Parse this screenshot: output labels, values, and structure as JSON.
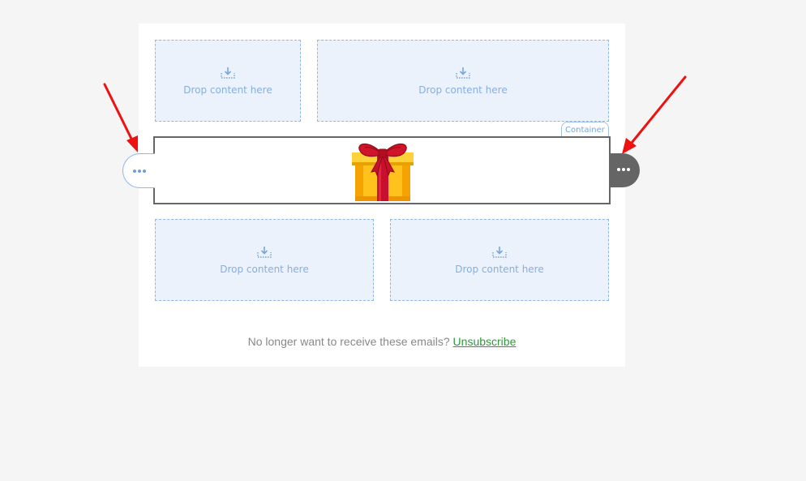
{
  "drop_zones": [
    {
      "label": "Drop content here",
      "icon": "download-tray-icon"
    },
    {
      "label": "Drop content here",
      "icon": "download-tray-icon"
    },
    {
      "label": "Drop content here",
      "icon": "download-tray-icon"
    },
    {
      "label": "Drop content here",
      "icon": "download-tray-icon"
    }
  ],
  "container_tag": {
    "label": "Container"
  },
  "selected_block": {
    "content": "gift-box-image"
  },
  "handles": {
    "left": {
      "icon": "more-dots-icon"
    },
    "right": {
      "icon": "more-dots-icon"
    }
  },
  "footer": {
    "text": "No longer want to receive these emails?",
    "link_label": "Unsubscribe"
  },
  "annotations": {
    "arrow_color": "#ee1111",
    "count": 2
  },
  "colors": {
    "drop_zone_bg": "#ebf2fc",
    "drop_zone_border": "#8fb8e6",
    "selected_border": "#666666",
    "link": "#2a9a3a",
    "page_bg": "#f5f5f5"
  }
}
